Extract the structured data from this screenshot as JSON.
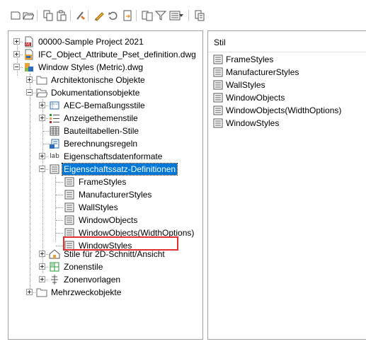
{
  "toolbar": {
    "icons": [
      "new-document-icon",
      "open-folder-icon",
      "copy-icon",
      "paste-icon",
      "purge-icon",
      "edit-style-icon",
      "sync-icon",
      "import-icon",
      "export-icon",
      "filter-icon",
      "view-mode-icon",
      "view-mode-dropdown-icon",
      "manage-icon"
    ]
  },
  "tree": {
    "n1": "00000-Sample Project 2021",
    "n2": "IFC_Object_Attribute_Pset_definition.dwg",
    "n3": "Window Styles (Metric).dwg",
    "n4": "Architektonische Objekte",
    "n5": "Dokumentationsobjekte",
    "n6": "AEC-Bemaßungsstile",
    "n7": "Anzeigethemenstile",
    "n8": "Bauteiltabellen-Stile",
    "n9": "Berechnungsregeln",
    "n10": "Eigenschaftsdatenformate",
    "n11": "Eigenschaftssatz-Definitionen",
    "n12": "FrameStyles",
    "n13": "ManufacturerStyles",
    "n14": "WallStyles",
    "n15": "WindowObjects",
    "n16": "WindowObjects(WidthOptions)",
    "n17": "WindowStyles",
    "n18": "Stile für 2D-Schnitt/Ansicht",
    "n19": "Zonenstile",
    "n20": "Zonenvorlagen",
    "n21": "Mehrzweckobjekte",
    "lab_text": "lab"
  },
  "list": {
    "header": "Stil",
    "items": [
      "FrameStyles",
      "ManufacturerStyles",
      "WallStyles",
      "WindowObjects",
      "WindowObjects(WidthOptions)",
      "WindowStyles"
    ]
  },
  "colors": {
    "selection": "#0078d7",
    "highlight_border": "#e03030",
    "folder_gray": "#6f6f6f",
    "dwg_orange": "#e8a13a"
  }
}
